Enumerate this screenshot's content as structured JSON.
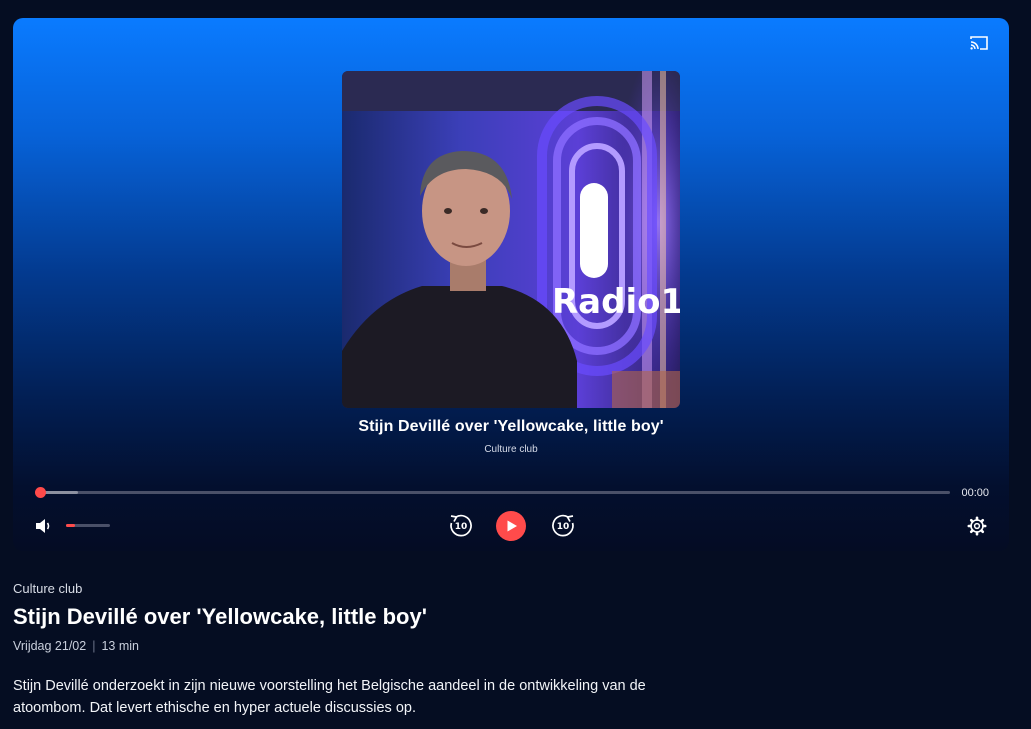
{
  "player": {
    "cast_icon": "cast-icon",
    "episode_title": "Stijn Devillé over 'Yellowcake, little boy'",
    "show_name": "Culture club",
    "artwork_logo_text": "Radio1",
    "current_time": "00:00",
    "progress_fraction": 0.0,
    "buffered_fraction": 0.042,
    "volume_fraction": 0.2,
    "skip_back_label": "10",
    "skip_forward_label": "10",
    "volume_icon": "volume-icon",
    "play_icon": "play-icon",
    "settings_icon": "gear-icon",
    "accent_color": "#ff4b4b"
  },
  "details": {
    "show_name": "Culture club",
    "title": "Stijn Devillé over 'Yellowcake, little boy'",
    "date": "Vrijdag 21/02",
    "separator": "|",
    "duration": "13 min",
    "description": "Stijn Devillé onderzoekt in zijn nieuwe voorstelling het Belgische aandeel in de ontwikkeling van de atoombom. Dat levert ethische en hyper actuele discussies op."
  }
}
